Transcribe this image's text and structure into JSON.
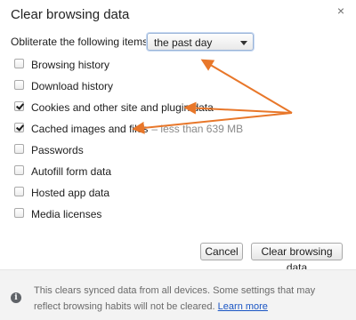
{
  "dialog": {
    "title": "Clear browsing data",
    "close_glyph": "×"
  },
  "period": {
    "label": "Obliterate the following items from:",
    "selected": "the past day"
  },
  "options": [
    {
      "label": "Browsing history",
      "checked": false,
      "extra": ""
    },
    {
      "label": "Download history",
      "checked": false,
      "extra": ""
    },
    {
      "label": "Cookies and other site and plugin data",
      "checked": true,
      "extra": ""
    },
    {
      "label": "Cached images and files",
      "checked": true,
      "extra": "– less than 639 MB"
    },
    {
      "label": "Passwords",
      "checked": false,
      "extra": ""
    },
    {
      "label": "Autofill form data",
      "checked": false,
      "extra": ""
    },
    {
      "label": "Hosted app data",
      "checked": false,
      "extra": ""
    },
    {
      "label": "Media licenses",
      "checked": false,
      "extra": ""
    }
  ],
  "buttons": {
    "cancel": "Cancel",
    "clear": "Clear browsing data"
  },
  "footer": {
    "text": "This clears synced data from all devices. Some settings that may reflect browsing habits will not be cleared.",
    "link": "Learn more",
    "icon": "info-icon"
  },
  "colors": {
    "annotation_arrow": "#e8772a",
    "link": "#1a55c4",
    "focus_ring": "#9ab4d8"
  }
}
